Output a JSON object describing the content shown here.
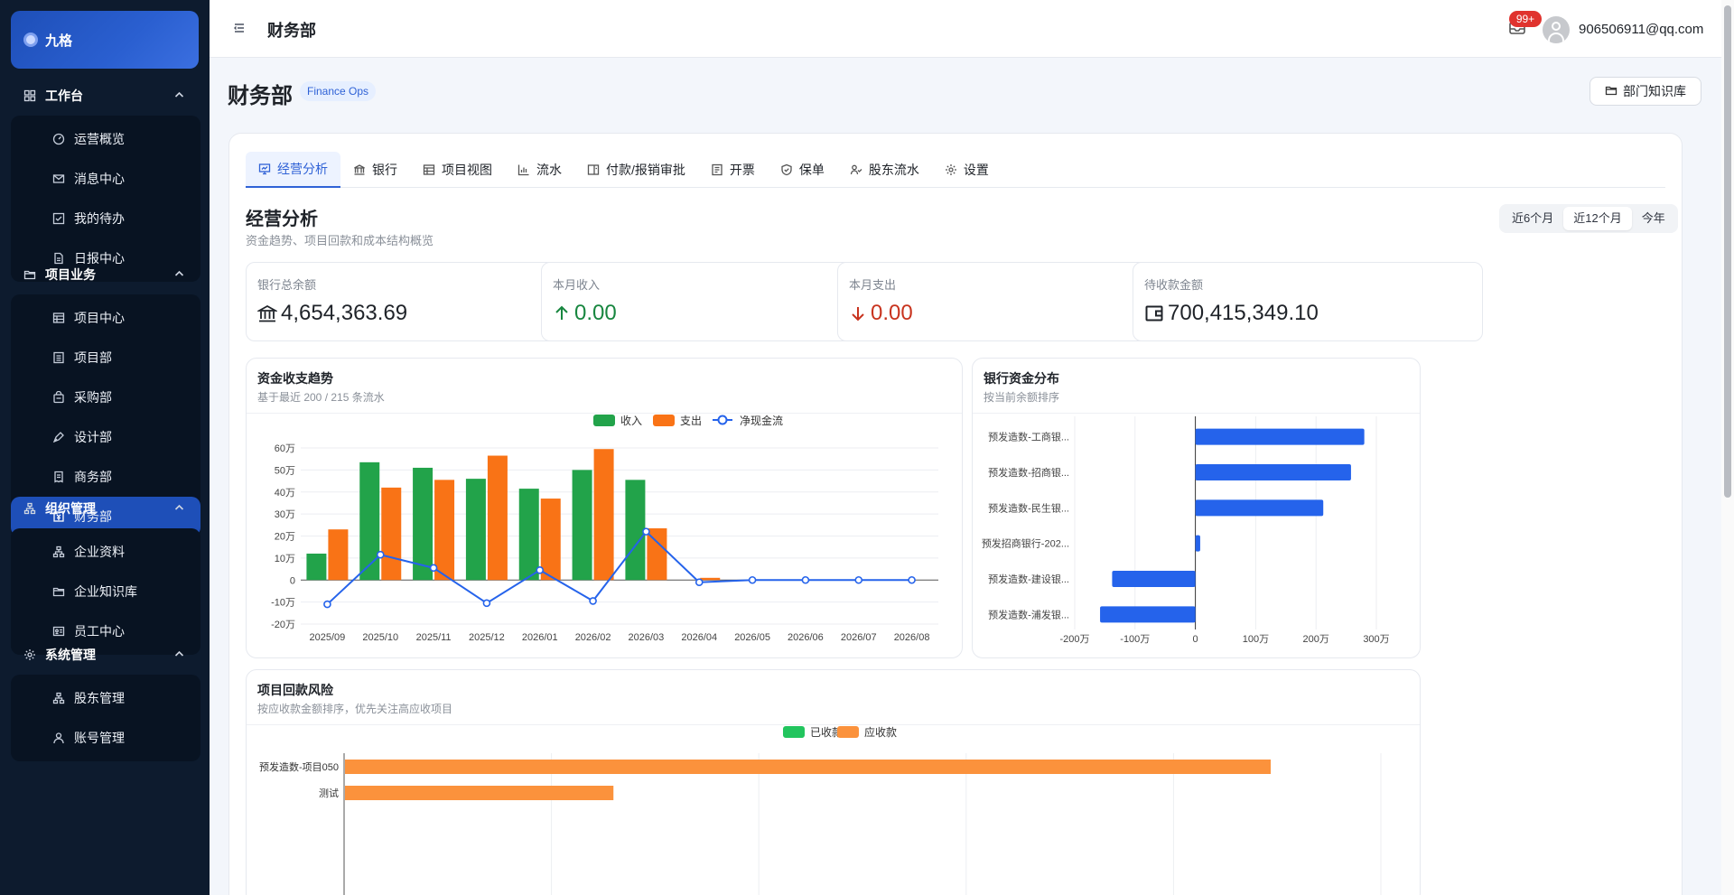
{
  "app": {
    "brand": "九格"
  },
  "sidebar": {
    "sections": [
      {
        "title": "工作台",
        "icon": "grid-icon",
        "items": [
          {
            "label": "运营概览",
            "icon": "dashboard-gauge-icon"
          },
          {
            "label": "消息中心",
            "icon": "mail-icon"
          },
          {
            "label": "我的待办",
            "icon": "checkbox-icon"
          },
          {
            "label": "日报中心",
            "icon": "document-icon"
          }
        ]
      },
      {
        "title": "项目业务",
        "icon": "folder-open-icon",
        "items": [
          {
            "label": "项目中心",
            "icon": "project-board-icon"
          },
          {
            "label": "项目部",
            "icon": "list-icon"
          },
          {
            "label": "采购部",
            "icon": "shopping-bag-icon"
          },
          {
            "label": "设计部",
            "icon": "pen-tool-icon"
          },
          {
            "label": "商务部",
            "icon": "receipt-icon"
          },
          {
            "label": "财务部",
            "icon": "finance-icon",
            "active": true
          }
        ]
      },
      {
        "title": "组织管理",
        "icon": "org-tree-icon",
        "items": [
          {
            "label": "企业资料",
            "icon": "org-tree-icon"
          },
          {
            "label": "企业知识库",
            "icon": "folder-open-icon"
          },
          {
            "label": "员工中心",
            "icon": "id-card-icon"
          }
        ]
      },
      {
        "title": "系统管理",
        "icon": "gear-icon",
        "items": [
          {
            "label": "股东管理",
            "icon": "org-tree-icon"
          },
          {
            "label": "账号管理",
            "icon": "user-icon"
          }
        ]
      }
    ]
  },
  "header": {
    "title": "财务部",
    "badge": "99+",
    "user_email": "906506911@qq.com"
  },
  "page": {
    "title": "财务部",
    "tag": "Finance Ops",
    "kb_button": "部门知识库"
  },
  "tabs": [
    {
      "label": "经营分析",
      "icon": "analysis-icon",
      "active": true
    },
    {
      "label": "银行",
      "icon": "bank-icon"
    },
    {
      "label": "项目视图",
      "icon": "project-board-icon"
    },
    {
      "label": "流水",
      "icon": "bar-chart-icon"
    },
    {
      "label": "付款/报销审批",
      "icon": "approval-icon"
    },
    {
      "label": "开票",
      "icon": "invoice-icon"
    },
    {
      "label": "保单",
      "icon": "shield-check-icon"
    },
    {
      "label": "股东流水",
      "icon": "shareholder-icon"
    },
    {
      "label": "设置",
      "icon": "gear-icon"
    }
  ],
  "analysis": {
    "title": "经营分析",
    "subtitle": "资金趋势、项目回款和成本结构概览",
    "ranges": [
      {
        "label": "近6个月"
      },
      {
        "label": "近12个月",
        "selected": true
      },
      {
        "label": "今年"
      }
    ]
  },
  "stats": [
    {
      "label": "银行总余额",
      "value": "4,654,363.69",
      "icon": "bank-icon",
      "tone": "neutral"
    },
    {
      "label": "本月收入",
      "value": "0.00",
      "icon": "arrow-up-icon",
      "tone": "green"
    },
    {
      "label": "本月支出",
      "value": "0.00",
      "icon": "arrow-down-icon",
      "tone": "red"
    },
    {
      "label": "待收款金额",
      "value": "700,415,349.10",
      "icon": "wallet-icon",
      "tone": "neutral"
    }
  ],
  "panels": {
    "trend": {
      "title": "资金收支趋势",
      "subtitle": "基于最近 200 / 215 条流水"
    },
    "bank": {
      "title": "银行资金分布",
      "subtitle": "按当前余额排序"
    },
    "project": {
      "title": "项目回款风险",
      "subtitle": "按应收款金额排序，优先关注高应收项目"
    }
  },
  "colors": {
    "income": "#22a34a",
    "expense": "#f97316",
    "net": "#2563eb",
    "collected": "#22c55e",
    "receivable": "#fb923c",
    "accent": "#1e4fb8"
  },
  "chart_data": [
    {
      "type": "bar",
      "title": "资金收支趋势",
      "categories": [
        "2025/09",
        "2025/10",
        "2025/11",
        "2025/12",
        "2026/01",
        "2026/02",
        "2026/03",
        "2026/04",
        "2026/05",
        "2026/06",
        "2026/07",
        "2026/08"
      ],
      "series": [
        {
          "name": "收入",
          "type": "bar",
          "values": [
            12,
            53.5,
            51,
            46,
            41.5,
            50,
            45.5,
            0,
            0,
            0,
            0,
            0
          ]
        },
        {
          "name": "支出",
          "type": "bar",
          "values": [
            23,
            42,
            45.5,
            56.5,
            37,
            59.5,
            23.5,
            1,
            0,
            0,
            0,
            0
          ]
        },
        {
          "name": "净现金流",
          "type": "line",
          "values": [
            -11,
            11.5,
            5.5,
            -10.5,
            4.5,
            -9.5,
            22,
            -1,
            0,
            0,
            0,
            0
          ]
        }
      ],
      "y_ticks": [
        "60万",
        "50万",
        "40万",
        "30万",
        "20万",
        "10万",
        "0",
        "-10万",
        "-20万"
      ],
      "ylim": [
        -20,
        60
      ],
      "grid": true,
      "legend": "top-center"
    },
    {
      "type": "bar",
      "title": "银行资金分布",
      "orientation": "horizontal",
      "categories": [
        "预发造数-工商银...",
        "预发造数-招商银...",
        "预发造数-民生银...",
        "预发招商银行-202...",
        "预发造数-建设银...",
        "预发造数-浦发银..."
      ],
      "values": [
        280,
        258,
        212,
        8,
        -138,
        -158
      ],
      "x_ticks": [
        "-200万",
        "-100万",
        "0",
        "100万",
        "200万",
        "300万"
      ],
      "xlim": [
        -200,
        300
      ],
      "grid": true
    },
    {
      "type": "bar",
      "title": "项目回款风险",
      "orientation": "horizontal",
      "categories": [
        "预发造数-项目050",
        "测试"
      ],
      "series": [
        {
          "name": "已收款",
          "values": [
            0,
            0
          ]
        },
        {
          "name": "应收款",
          "values": [
            100,
            29
          ]
        }
      ],
      "legend": "top-center"
    }
  ]
}
